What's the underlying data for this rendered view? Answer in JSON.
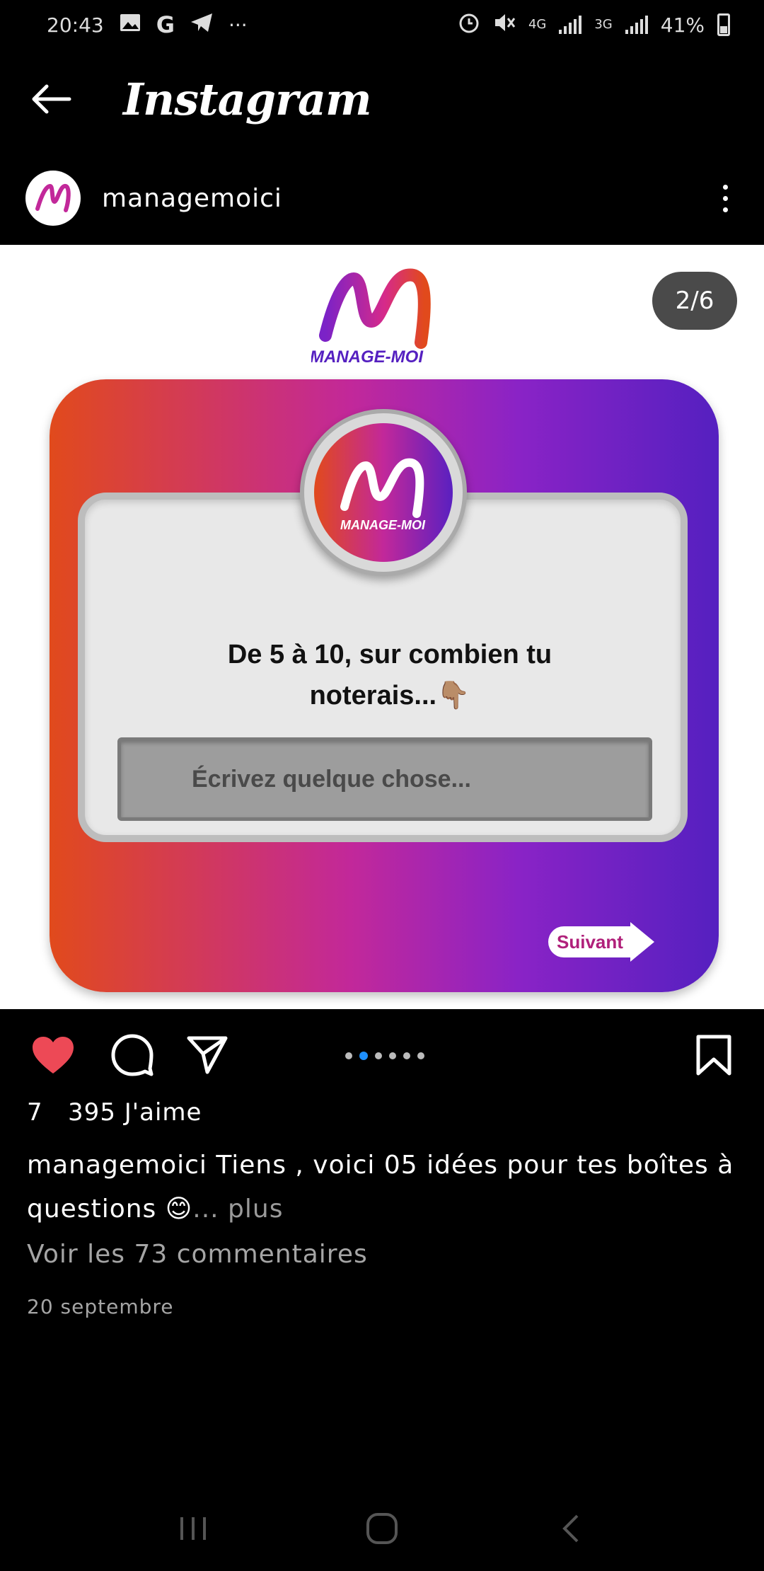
{
  "status_bar": {
    "time": "20:43",
    "google_letter": "G",
    "more": "···",
    "network_1": "4G",
    "network_2": "3G",
    "battery": "41%"
  },
  "header": {
    "title": "Instagram"
  },
  "post": {
    "username": "managemoici",
    "counter": "2/6",
    "image": {
      "brand": "MANAGE-MOI",
      "question_line1": "De 5 à 10, sur combien tu",
      "question_line2": "noterais...👇🏽",
      "answer_placeholder": "Écrivez quelque chose...",
      "next_label": "Suivant"
    },
    "carousel": {
      "total": 6,
      "active_index": 1
    },
    "likes_text": "7   395 J'aime",
    "caption_user": "managemoici",
    "caption_text": " Tiens , voici 05 idées pour tes boîtes à questions 😊",
    "caption_more": "... plus",
    "view_comments": "Voir les 73 commentaires",
    "date": "20 septembre"
  },
  "colors": {
    "like": "#ed4956",
    "carousel_active": "#1e90ff",
    "gradient_start": "#e14a1c",
    "gradient_end": "#5520c0"
  },
  "icons": [
    "back-arrow-icon",
    "heart-icon",
    "comment-icon",
    "share-icon",
    "bookmark-icon",
    "more-vertical-icon"
  ]
}
